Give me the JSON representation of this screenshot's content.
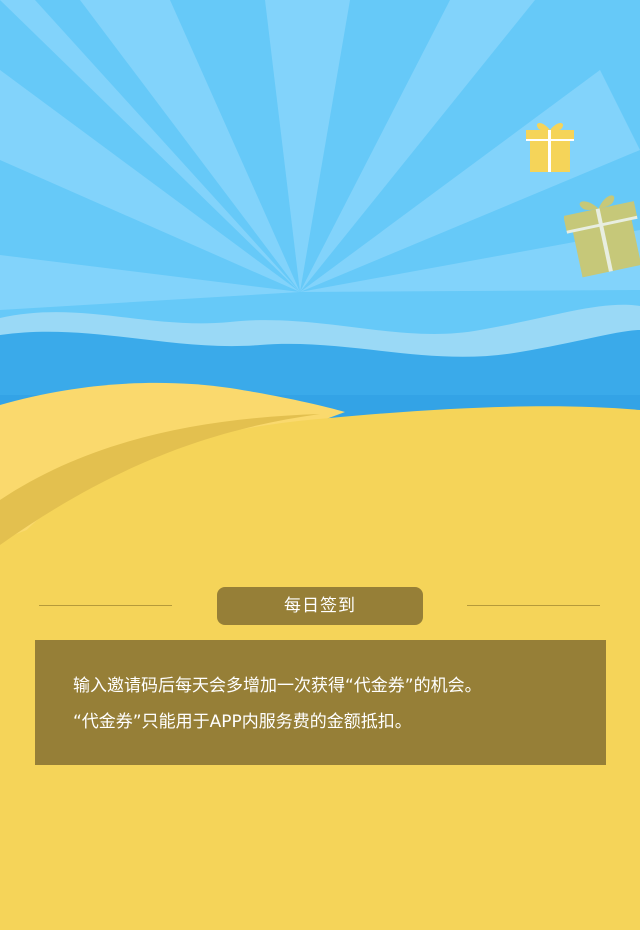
{
  "checkin": {
    "title": "每日签到",
    "description_lines": [
      "输入邀请码后每天会多增加一次获得“代金券”的机会。",
      "“代金券”只能用于APP内服务费的金额抵扣。"
    ]
  },
  "colors": {
    "sky": "#66c9f8",
    "sea": "#3aaaea",
    "sand": "#f5d459",
    "panel": "#967f37"
  },
  "decorations": {
    "icons": [
      "gift-icon",
      "gift-icon"
    ]
  }
}
